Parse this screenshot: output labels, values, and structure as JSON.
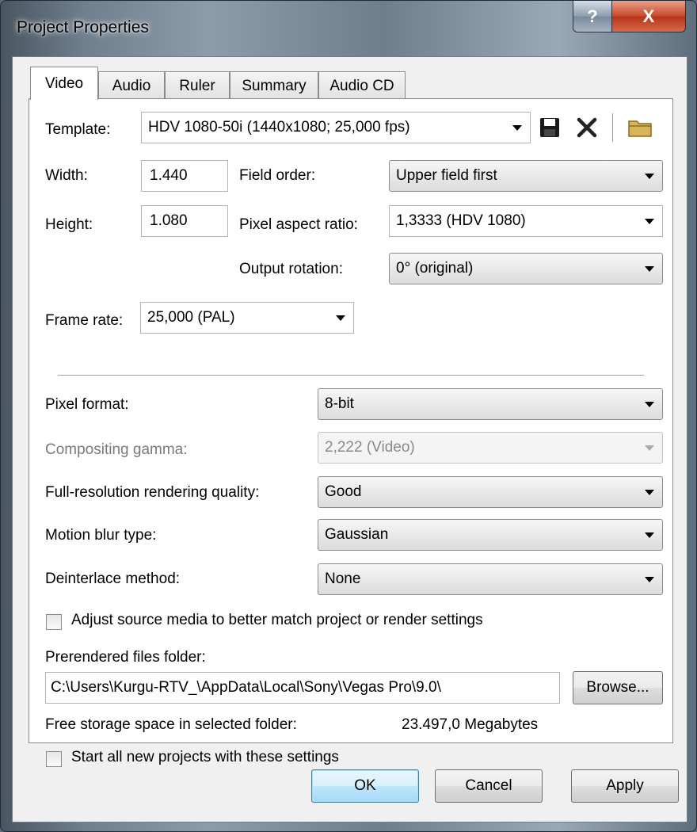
{
  "window": {
    "title": "Project Properties",
    "help_label": "?",
    "close_label": "X"
  },
  "tabs": [
    {
      "label": "Video",
      "active": true
    },
    {
      "label": "Audio",
      "active": false
    },
    {
      "label": "Ruler",
      "active": false
    },
    {
      "label": "Summary",
      "active": false
    },
    {
      "label": "Audio CD",
      "active": false
    }
  ],
  "video": {
    "template": {
      "label": "Template:",
      "value": "HDV 1080-50i (1440x1080; 25,000 fps)"
    },
    "width": {
      "label": "Width:",
      "value": "1.440"
    },
    "height": {
      "label": "Height:",
      "value": "1.080"
    },
    "field_order": {
      "label": "Field order:",
      "value": "Upper field first"
    },
    "pixel_aspect_ratio": {
      "label": "Pixel aspect ratio:",
      "value": "1,3333 (HDV 1080)"
    },
    "output_rotation": {
      "label": "Output rotation:",
      "value": "0° (original)"
    },
    "frame_rate": {
      "label": "Frame rate:",
      "value": "25,000 (PAL)"
    },
    "pixel_format": {
      "label": "Pixel format:",
      "value": "8-bit"
    },
    "compositing_gamma": {
      "label": "Compositing gamma:",
      "value": "2,222 (Video)"
    },
    "rendering_quality": {
      "label": "Full-resolution rendering quality:",
      "value": "Good"
    },
    "motion_blur": {
      "label": "Motion blur type:",
      "value": "Gaussian"
    },
    "deinterlace": {
      "label": "Deinterlace method:",
      "value": "None"
    },
    "adjust_source": {
      "label": "Adjust source media to better match project or render settings",
      "checked": false
    },
    "prerendered": {
      "label": "Prerendered files folder:",
      "value": "C:\\Users\\Kurgu-RTV_\\AppData\\Local\\Sony\\Vegas Pro\\9.0\\",
      "browse_label": "Browse..."
    },
    "free_storage": {
      "label": "Free storage space in selected folder:",
      "value": "23.497,0 Megabytes"
    },
    "start_new": {
      "label": "Start all new projects with these settings",
      "checked": false
    }
  },
  "buttons": {
    "ok": "OK",
    "cancel": "Cancel",
    "apply": "Apply"
  },
  "colors": {
    "save_icon": "#1a1a1a",
    "delete_icon": "#222222",
    "folder_icon": "#d9b45a"
  }
}
